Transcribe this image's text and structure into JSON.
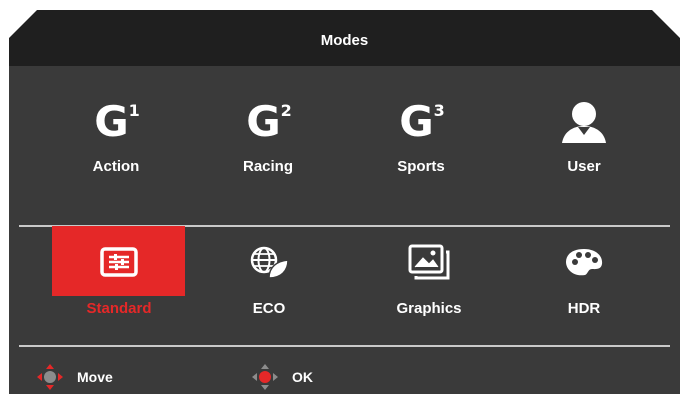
{
  "header": {
    "title": "Modes"
  },
  "modes_row1": [
    {
      "icon": "g1-icon",
      "glyph": "G",
      "sup": "1",
      "label": "Action"
    },
    {
      "icon": "g2-icon",
      "glyph": "G",
      "sup": "2",
      "label": "Racing"
    },
    {
      "icon": "g3-icon",
      "glyph": "G",
      "sup": "3",
      "label": "Sports"
    },
    {
      "icon": "user-icon",
      "label": "User"
    }
  ],
  "modes_row2": [
    {
      "icon": "standard-icon",
      "label": "Standard",
      "selected": true
    },
    {
      "icon": "eco-icon",
      "label": "ECO"
    },
    {
      "icon": "graphics-icon",
      "label": "Graphics"
    },
    {
      "icon": "hdr-icon",
      "label": "HDR"
    }
  ],
  "footer": {
    "move_label": "Move",
    "ok_label": "OK"
  },
  "colors": {
    "panel": "#3a3a3a",
    "header": "#1f1f1f",
    "accent": "#e52828",
    "nav_center_move": "#8c8c8c",
    "nav_center_ok": "#e52828"
  }
}
